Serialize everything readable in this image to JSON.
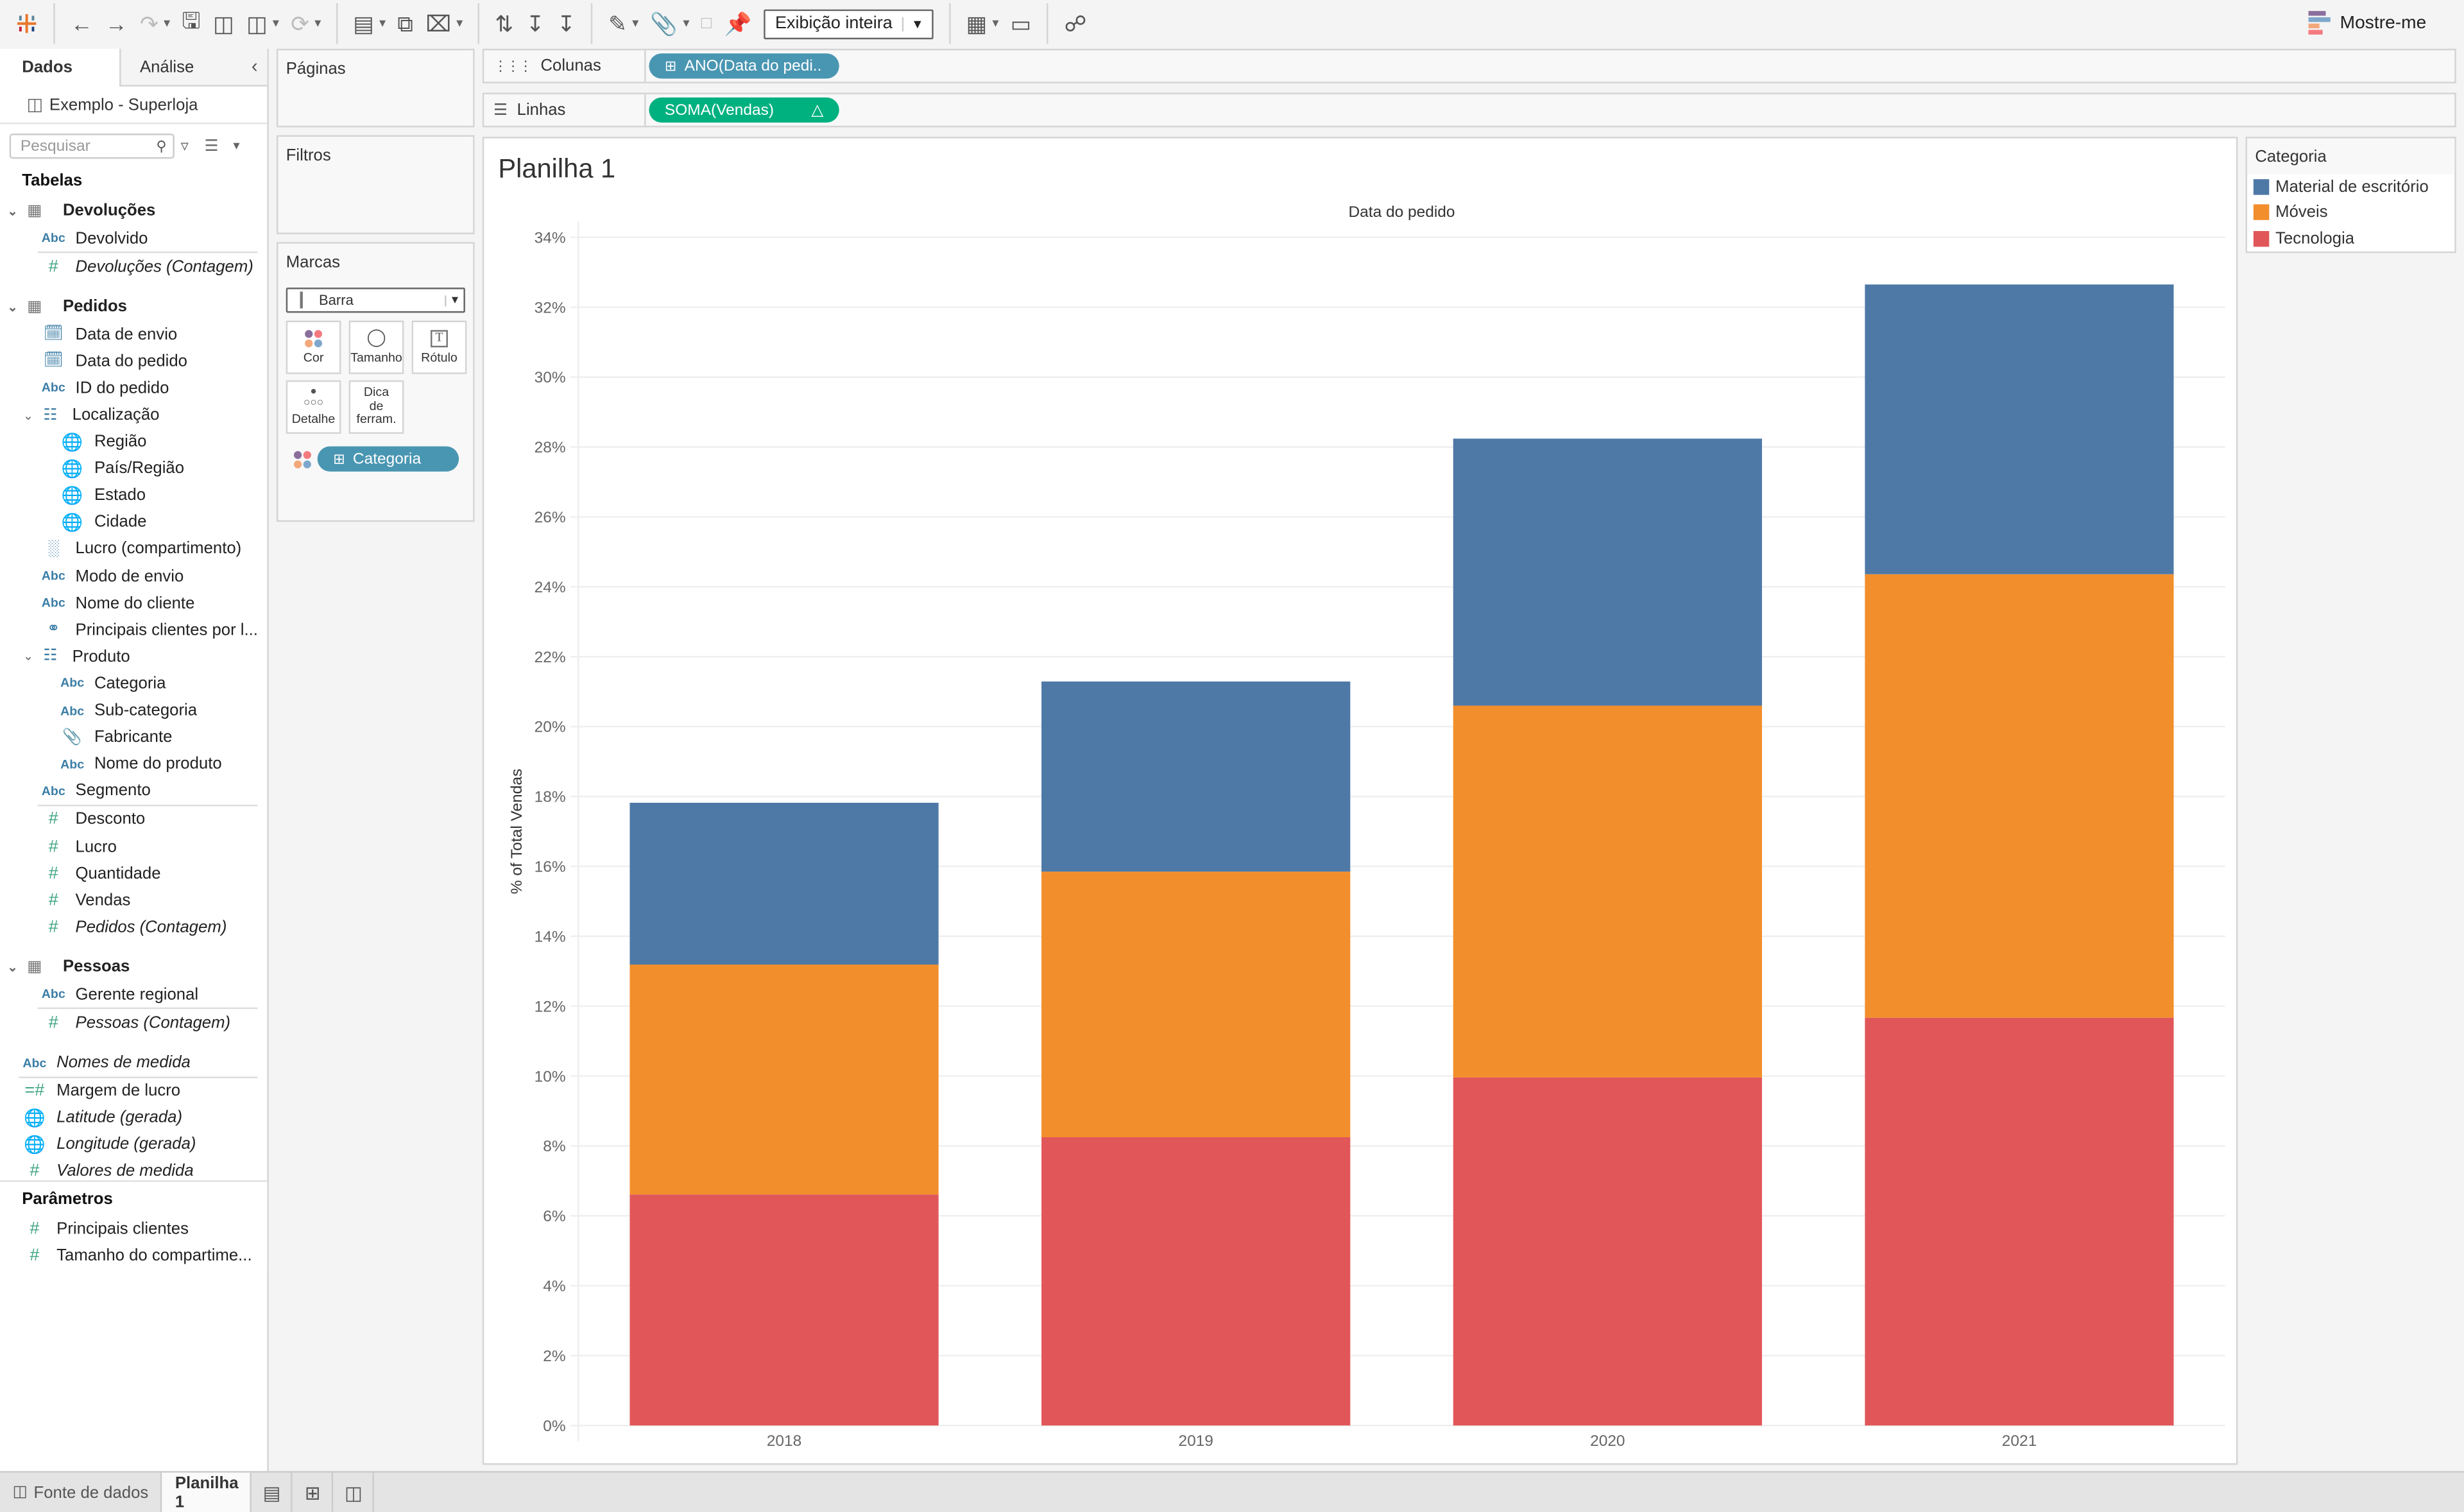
{
  "toolbar": {
    "fit_select": "Exibição inteira",
    "show_me": "Mostre-me",
    "show_me_colors": [
      "#8a6f9c",
      "#7fa7cc",
      "#f3a87c",
      "#f47a80"
    ]
  },
  "data_pane": {
    "tabs": [
      "Dados",
      "Análise"
    ],
    "source": "Exemplo - Superloja",
    "search_placeholder": "Pesquisar",
    "tables_heading": "Tabelas",
    "parameters_heading": "Parâmetros",
    "tree": [
      {
        "kind": "table",
        "label": "Devoluções",
        "icon": "table-icon",
        "chev": true
      },
      {
        "kind": "dim",
        "label": "Devolvido",
        "icon": "abc-icon",
        "indent": 1
      },
      {
        "kind": "sep"
      },
      {
        "kind": "measure",
        "label": "Devoluções (Contagem)",
        "icon": "number-icon",
        "indent": 1,
        "italic": true
      },
      {
        "kind": "gap"
      },
      {
        "kind": "table",
        "label": "Pedidos",
        "icon": "table-icon",
        "chev": true
      },
      {
        "kind": "dim",
        "label": "Data de envio",
        "icon": "calendar-icon",
        "indent": 1
      },
      {
        "kind": "dim",
        "label": "Data do pedido",
        "icon": "calendar-icon",
        "indent": 1
      },
      {
        "kind": "dim",
        "label": "ID do pedido",
        "icon": "abc-icon",
        "indent": 1
      },
      {
        "kind": "dim",
        "label": "Localização",
        "icon": "hierarchy-icon",
        "indent": 1,
        "chev": true
      },
      {
        "kind": "dim",
        "label": "Região",
        "icon": "globe-icon",
        "indent": 2
      },
      {
        "kind": "dim",
        "label": "País/Região",
        "icon": "globe-icon",
        "indent": 2
      },
      {
        "kind": "dim",
        "label": "Estado",
        "icon": "globe-icon",
        "indent": 2
      },
      {
        "kind": "dim",
        "label": "Cidade",
        "icon": "globe-icon",
        "indent": 2
      },
      {
        "kind": "dim",
        "label": "Lucro (compartimento)",
        "icon": "bin-icon",
        "indent": 1
      },
      {
        "kind": "dim",
        "label": "Modo de envio",
        "icon": "abc-icon",
        "indent": 1
      },
      {
        "kind": "dim",
        "label": "Nome do cliente",
        "icon": "abc-icon",
        "indent": 1
      },
      {
        "kind": "dim",
        "label": "Principais clientes por l...",
        "icon": "set-icon",
        "indent": 1
      },
      {
        "kind": "dim",
        "label": "Produto",
        "icon": "hierarchy-icon",
        "indent": 1,
        "chev": true
      },
      {
        "kind": "dim",
        "label": "Categoria",
        "icon": "abc-icon",
        "indent": 2
      },
      {
        "kind": "dim",
        "label": "Sub-categoria",
        "icon": "abc-icon",
        "indent": 2
      },
      {
        "kind": "dim",
        "label": "Fabricante",
        "icon": "paperclip-icon",
        "indent": 2
      },
      {
        "kind": "dim",
        "label": "Nome do produto",
        "icon": "abc-icon",
        "indent": 2
      },
      {
        "kind": "dim",
        "label": "Segmento",
        "icon": "abc-icon",
        "indent": 1
      },
      {
        "kind": "sep"
      },
      {
        "kind": "measure",
        "label": "Desconto",
        "icon": "number-icon",
        "indent": 1
      },
      {
        "kind": "measure",
        "label": "Lucro",
        "icon": "number-icon",
        "indent": 1
      },
      {
        "kind": "measure",
        "label": "Quantidade",
        "icon": "number-icon",
        "indent": 1
      },
      {
        "kind": "measure",
        "label": "Vendas",
        "icon": "number-icon",
        "indent": 1
      },
      {
        "kind": "measure",
        "label": "Pedidos (Contagem)",
        "icon": "number-icon",
        "indent": 1,
        "italic": true
      },
      {
        "kind": "gap"
      },
      {
        "kind": "table",
        "label": "Pessoas",
        "icon": "table-icon",
        "chev": true
      },
      {
        "kind": "dim",
        "label": "Gerente regional",
        "icon": "abc-icon",
        "indent": 1
      },
      {
        "kind": "sep"
      },
      {
        "kind": "measure",
        "label": "Pessoas (Contagem)",
        "icon": "number-icon",
        "indent": 1,
        "italic": true
      },
      {
        "kind": "gap"
      },
      {
        "kind": "dim",
        "label": "Nomes de medida",
        "icon": "abc-icon",
        "indent": 0,
        "italic": true
      },
      {
        "kind": "sep0"
      },
      {
        "kind": "measure",
        "label": "Margem de lucro",
        "icon": "calc-number-icon",
        "indent": 0
      },
      {
        "kind": "measure",
        "label": "Latitude (gerada)",
        "icon": "globe-icon",
        "indent": 0,
        "italic": true
      },
      {
        "kind": "measure",
        "label": "Longitude (gerada)",
        "icon": "globe-icon",
        "indent": 0,
        "italic": true
      },
      {
        "kind": "measure",
        "label": "Valores de medida",
        "icon": "number-icon",
        "indent": 0,
        "italic": true
      }
    ],
    "parameters": [
      {
        "label": "Principais clientes",
        "icon": "number-icon"
      },
      {
        "label": "Tamanho do compartime...",
        "icon": "number-icon"
      }
    ]
  },
  "cards": {
    "pages": "Páginas",
    "filters": "Filtros",
    "marks": "Marcas",
    "mark_type": "Barra",
    "mark_buttons": [
      "Cor",
      "Tamanho",
      "Rótulo",
      "Detalhe",
      "Dica de ferram."
    ],
    "color_pill": "Categoria"
  },
  "shelves": {
    "columns_label": "Colunas",
    "columns_pill": "ANO(Data do pedi..",
    "rows_label": "Linhas",
    "rows_pill": "SOMA(Vendas)",
    "rows_pill_badge": "△"
  },
  "sheet": {
    "title": "Planilha 1"
  },
  "legend": {
    "title": "Categoria",
    "items": [
      {
        "label": "Material de escritório",
        "color": "#4e79a7"
      },
      {
        "label": "Móveis",
        "color": "#f28e2b"
      },
      {
        "label": "Tecnologia",
        "color": "#e15759"
      }
    ]
  },
  "bottom_tabs": {
    "data_source": "Fonte de dados",
    "sheet": "Planilha 1"
  },
  "chart_data": {
    "type": "bar",
    "stacked": true,
    "title": "Planilha 1",
    "column_header": "Data do pedido",
    "xlabel": "",
    "ylabel": "% of Total Vendas",
    "categories": [
      "2018",
      "2019",
      "2020",
      "2021"
    ],
    "series": [
      {
        "name": "Tecnologia",
        "color": "#e15759",
        "values": [
          6.61,
          8.25,
          9.96,
          11.67
        ]
      },
      {
        "name": "Móveis",
        "color": "#f28e2b",
        "values": [
          6.58,
          7.6,
          10.64,
          12.69
        ]
      },
      {
        "name": "Material de escritório",
        "color": "#4e79a7",
        "values": [
          4.63,
          5.44,
          7.64,
          8.29
        ]
      }
    ],
    "ylim": [
      0,
      34
    ],
    "yticks": [
      0,
      2,
      4,
      6,
      8,
      10,
      12,
      14,
      16,
      18,
      20,
      22,
      24,
      26,
      28,
      30,
      32,
      34
    ],
    "ytick_suffix": "%",
    "grid": true,
    "legend_position": "right"
  }
}
